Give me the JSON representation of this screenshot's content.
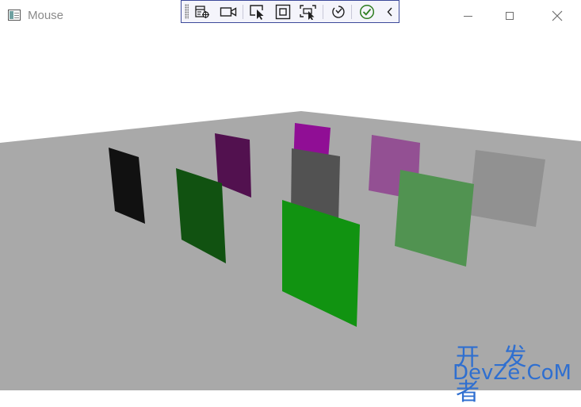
{
  "window": {
    "title": "Mouse",
    "icon": "app-window-icon",
    "controls": {
      "minimize": "minimize-icon",
      "maximize": "maximize-icon",
      "close": "close-icon"
    }
  },
  "debug_toolbar": {
    "tools": [
      "live-visual-tree-icon",
      "record-camera-icon",
      "select-element-icon",
      "display-layout-adorners-icon",
      "track-focus-icon",
      "hot-reload-icon",
      "hot-reload-ok-icon",
      "collapse-chevron-icon"
    ]
  },
  "scene": {
    "floor_color": "#a9a9a9",
    "background_color": "#ffffff",
    "panels": [
      {
        "name": "black",
        "color": "#111111"
      },
      {
        "name": "dark-purple",
        "color": "#52114f"
      },
      {
        "name": "magenta",
        "color": "#900e95"
      },
      {
        "name": "orchid",
        "color": "#935093"
      },
      {
        "name": "dark-green",
        "color": "#115211"
      },
      {
        "name": "dark-gray",
        "color": "#525252"
      },
      {
        "name": "gray",
        "color": "#919191"
      },
      {
        "name": "light-green",
        "color": "#519351"
      },
      {
        "name": "green",
        "color": "#119311"
      }
    ]
  },
  "watermark": {
    "cn": "开 发 者",
    "en": "DevZe.CoM"
  }
}
